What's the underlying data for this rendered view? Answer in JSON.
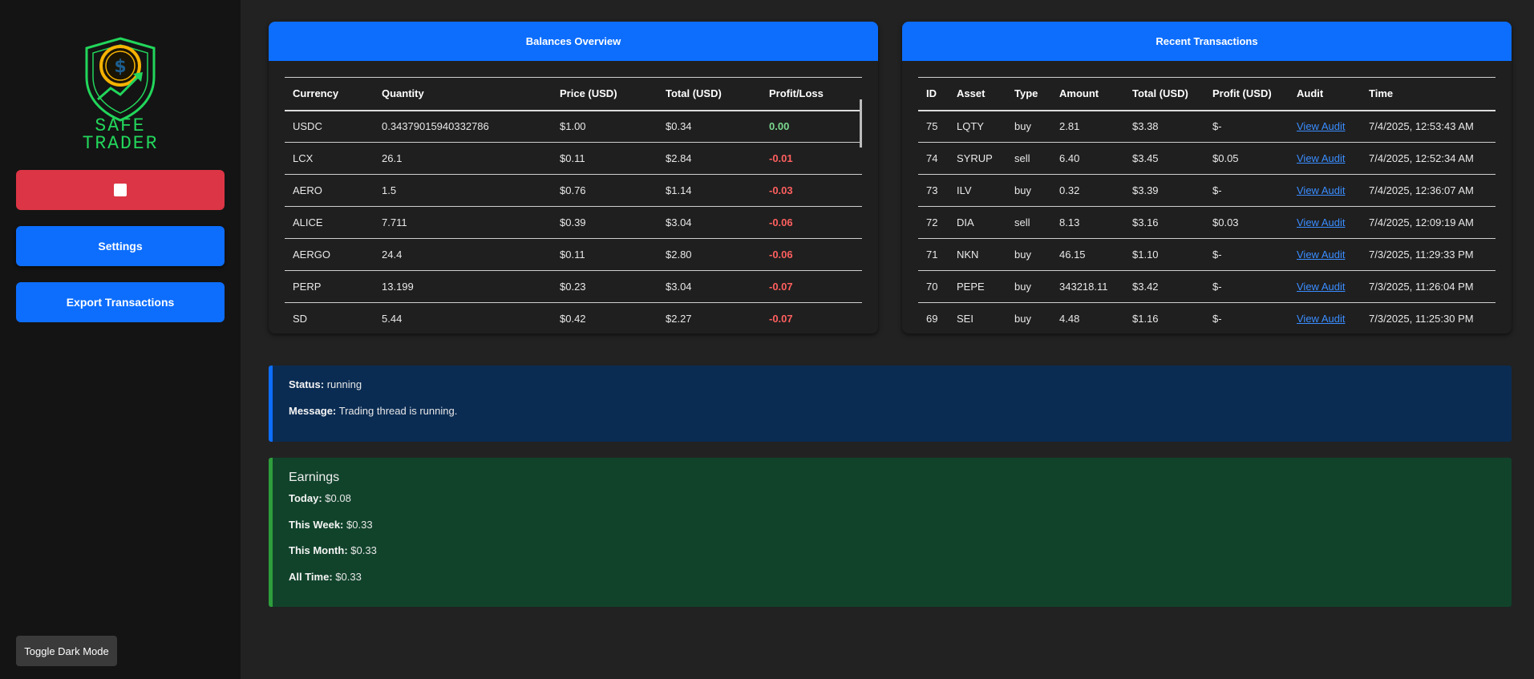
{
  "sidebar": {
    "logo_line1": "SAFE",
    "logo_line2": "TRADER",
    "settings_label": "Settings",
    "export_label": "Export Transactions",
    "dark_mode_label": "Toggle Dark Mode",
    "colors": {
      "stop": "#dc3545",
      "primary": "#0d6efd",
      "logo": "#22d65b"
    }
  },
  "balances": {
    "title": "Balances Overview",
    "headers": [
      "Currency",
      "Quantity",
      "Price (USD)",
      "Total (USD)",
      "Profit/Loss"
    ],
    "rows": [
      {
        "currency": "USDC",
        "quantity": "0.34379015940332786",
        "price": "$1.00",
        "total": "$0.34",
        "pl": "0.00",
        "pl_sign": "pos"
      },
      {
        "currency": "LCX",
        "quantity": "26.1",
        "price": "$0.11",
        "total": "$2.84",
        "pl": "-0.01",
        "pl_sign": "neg"
      },
      {
        "currency": "AERO",
        "quantity": "1.5",
        "price": "$0.76",
        "total": "$1.14",
        "pl": "-0.03",
        "pl_sign": "neg"
      },
      {
        "currency": "ALICE",
        "quantity": "7.711",
        "price": "$0.39",
        "total": "$3.04",
        "pl": "-0.06",
        "pl_sign": "neg"
      },
      {
        "currency": "AERGO",
        "quantity": "24.4",
        "price": "$0.11",
        "total": "$2.80",
        "pl": "-0.06",
        "pl_sign": "neg"
      },
      {
        "currency": "PERP",
        "quantity": "13.199",
        "price": "$0.23",
        "total": "$3.04",
        "pl": "-0.07",
        "pl_sign": "neg"
      },
      {
        "currency": "SD",
        "quantity": "5.44",
        "price": "$0.42",
        "total": "$2.27",
        "pl": "-0.07",
        "pl_sign": "neg"
      }
    ]
  },
  "transactions": {
    "title": "Recent Transactions",
    "headers": [
      "ID",
      "Asset",
      "Type",
      "Amount",
      "Total (USD)",
      "Profit (USD)",
      "Audit",
      "Time"
    ],
    "rows": [
      {
        "id": "75",
        "asset": "LQTY",
        "type": "buy",
        "amount": "2.81",
        "total": "$3.38",
        "profit": "$-",
        "audit": "View Audit",
        "time": "7/4/2025, 12:53:43 AM"
      },
      {
        "id": "74",
        "asset": "SYRUP",
        "type": "sell",
        "amount": "6.40",
        "total": "$3.45",
        "profit": "$0.05",
        "audit": "View Audit",
        "time": "7/4/2025, 12:52:34 AM"
      },
      {
        "id": "73",
        "asset": "ILV",
        "type": "buy",
        "amount": "0.32",
        "total": "$3.39",
        "profit": "$-",
        "audit": "View Audit",
        "time": "7/4/2025, 12:36:07 AM"
      },
      {
        "id": "72",
        "asset": "DIA",
        "type": "sell",
        "amount": "8.13",
        "total": "$3.16",
        "profit": "$0.03",
        "audit": "View Audit",
        "time": "7/4/2025, 12:09:19 AM"
      },
      {
        "id": "71",
        "asset": "NKN",
        "type": "buy",
        "amount": "46.15",
        "total": "$1.10",
        "profit": "$-",
        "audit": "View Audit",
        "time": "7/3/2025, 11:29:33 PM"
      },
      {
        "id": "70",
        "asset": "PEPE",
        "type": "buy",
        "amount": "343218.11",
        "total": "$3.42",
        "profit": "$-",
        "audit": "View Audit",
        "time": "7/3/2025, 11:26:04 PM"
      },
      {
        "id": "69",
        "asset": "SEI",
        "type": "buy",
        "amount": "4.48",
        "total": "$1.16",
        "profit": "$-",
        "audit": "View Audit",
        "time": "7/3/2025, 11:25:30 PM"
      }
    ]
  },
  "status": {
    "status_label": "Status:",
    "status_value": "running",
    "message_label": "Message:",
    "message_value": "Trading thread is running."
  },
  "earnings": {
    "title": "Earnings",
    "items": [
      {
        "label": "Today:",
        "value": "$0.08"
      },
      {
        "label": "This Week:",
        "value": "$0.33"
      },
      {
        "label": "This Month:",
        "value": "$0.33"
      },
      {
        "label": "All Time:",
        "value": "$0.33"
      }
    ]
  }
}
